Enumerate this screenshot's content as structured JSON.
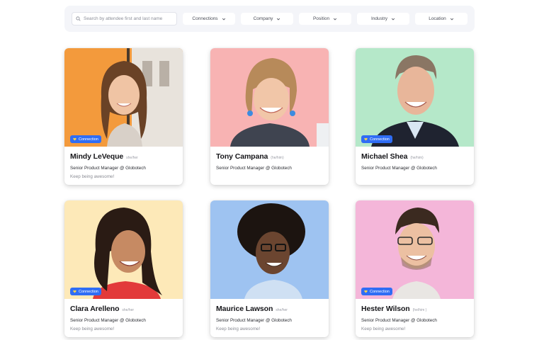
{
  "search": {
    "placeholder": "Search by attendee first and last name"
  },
  "filters": [
    {
      "label": "Connections"
    },
    {
      "label": "Company"
    },
    {
      "label": "Position"
    },
    {
      "label": "Industry"
    },
    {
      "label": "Location"
    }
  ],
  "attendees": [
    {
      "name": "Mindy LeVeque",
      "pronouns": "she/her",
      "role": "Senior Product Manager @ Globotech",
      "bio": "Keep being awesome!",
      "badge": "Connection",
      "bg": "#f39a3c"
    },
    {
      "name": "Tony Campana",
      "pronouns": "(he/him)",
      "role": "Senior Product Manager @ Globotech",
      "bio": "",
      "badge": "",
      "bg": "#f8b3b3"
    },
    {
      "name": "Michael Shea",
      "pronouns": "(he/him)",
      "role": "Senior Product Manager @ Globotech",
      "bio": "",
      "badge": "Connection",
      "bg": "#b5e8c9"
    },
    {
      "name": "Clara Arelleno",
      "pronouns": "she/her",
      "role": "Senior Product Manager @ Globotech",
      "bio": "Keep being awesome!",
      "badge": "Connection",
      "bg": "#fde9b8"
    },
    {
      "name": "Maurice Lawson",
      "pronouns": "she/her",
      "role": "Senior Product Manager @ Globotech",
      "bio": "Keep being awesome!",
      "badge": "",
      "bg": "#9ec3f1"
    },
    {
      "name": "Hester Wilson",
      "pronouns": "(he/him )",
      "role": "Senior Product Manager @ Globotech",
      "bio": "Keep being awesome!",
      "badge": "Connection",
      "bg": "#f4b6d9"
    }
  ],
  "colors": {
    "accent": "#2f6df5",
    "filterbar": "#f4f5f9"
  },
  "icons": {
    "search": "search-icon",
    "chevron": "chevron-down-icon",
    "badge": "heart-icon"
  }
}
